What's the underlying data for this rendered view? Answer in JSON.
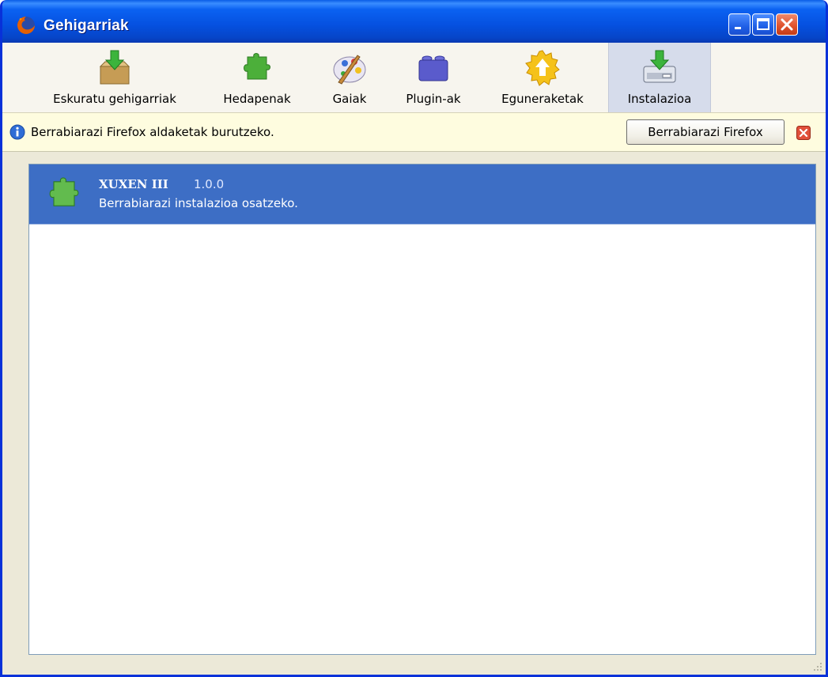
{
  "window": {
    "title": "Gehigarriak",
    "controls": [
      "minimize-icon",
      "maximize-icon",
      "close-icon"
    ]
  },
  "toolbar": {
    "items": [
      {
        "label": "Eskuratu gehigarriak",
        "icon": "get-addons-icon"
      },
      {
        "label": "Hedapenak",
        "icon": "puzzle-icon"
      },
      {
        "label": "Gaiak",
        "icon": "palette-icon"
      },
      {
        "label": "Plugin-ak",
        "icon": "plugin-block-icon"
      },
      {
        "label": "Eguneraketak",
        "icon": "update-icon"
      },
      {
        "label": "Instalazioa",
        "icon": "install-icon",
        "selected": true
      }
    ]
  },
  "notification": {
    "message": "Berrabiarazi Firefox aldaketak burutzeko.",
    "button_label": "Berrabiarazi Firefox",
    "icon": "info-icon"
  },
  "addons": [
    {
      "name": "XUXEN III",
      "version": "1.0.0",
      "status": "Berrabiarazi instalazioa osatzeko.",
      "icon": "puzzle-icon"
    }
  ],
  "colors": {
    "titlebar": "#0550df",
    "selection": "#3d6ec5",
    "notice_bg": "#fefcdf",
    "window_bg": "#ece9d8"
  }
}
